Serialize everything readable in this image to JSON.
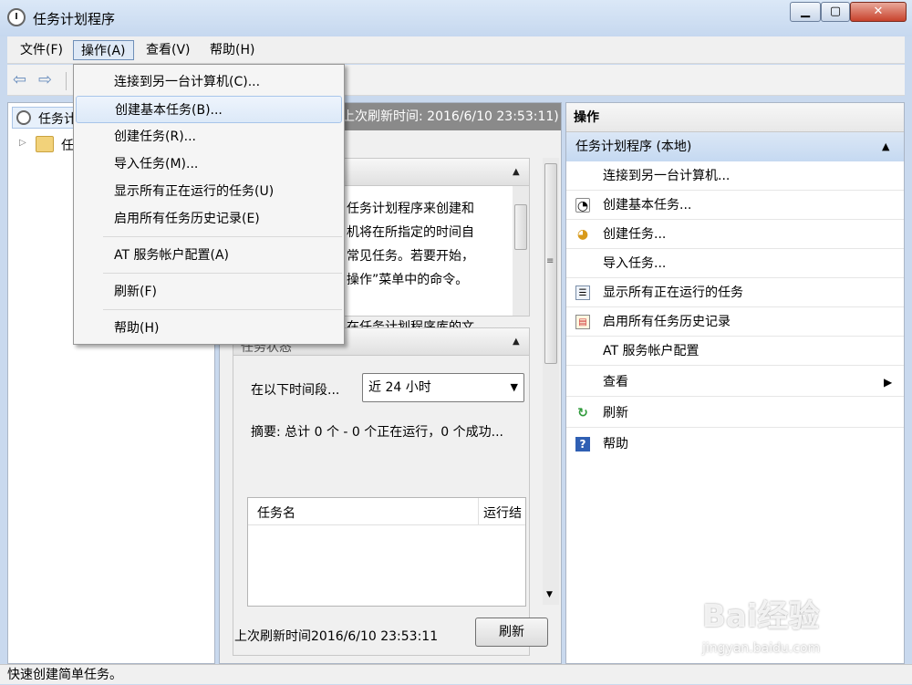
{
  "window": {
    "title": "任务计划程序",
    "min": "▁",
    "max": "▢",
    "close": "✕"
  },
  "menubar": {
    "items": [
      "文件(F)",
      "操作(A)",
      "查看(V)",
      "帮助(H)"
    ]
  },
  "toolbar": {
    "back": "⇦",
    "forward": "⇨"
  },
  "tree": {
    "root": "任务计",
    "child": "任"
  },
  "center": {
    "header": "上次刷新时间: 2016/6/10 23:53:11)",
    "overview_lines": [
      "任务计划程序来创建和",
      "机将在所指定的时间自",
      "常见任务。若要开始，",
      "操作”菜单中的命令。",
      "",
      "在任务计划程序库的文"
    ],
    "status_title": "任务状态",
    "period_label": "在以下时间段...",
    "period_value": "近 24 小时",
    "summary": "摘要: 总计 0 个 - 0 个正在运行，0 个成功...",
    "table_cols": [
      "任务名",
      "运行结"
    ],
    "last_refresh": "上次刷新时间2016/6/10 23:53:11",
    "refresh_btn": "刷新"
  },
  "actions": {
    "title": "操作",
    "group": "任务计划程序 (本地)",
    "items": [
      {
        "label": "连接到另一台计算机...",
        "icon": ""
      },
      {
        "label": "创建基本任务...",
        "icon": "clock-icon"
      },
      {
        "label": "创建任务...",
        "icon": "task-icon"
      },
      {
        "label": "导入任务...",
        "icon": ""
      },
      {
        "label": "显示所有正在运行的任务",
        "icon": "list-icon"
      },
      {
        "label": "启用所有任务历史记录",
        "icon": "history-icon"
      },
      {
        "label": "AT 服务帐户配置",
        "icon": ""
      },
      {
        "label": "查看",
        "icon": ""
      },
      {
        "label": "刷新",
        "icon": "refresh-icon"
      },
      {
        "label": "帮助",
        "icon": "help-icon"
      }
    ]
  },
  "dropdown": {
    "items": [
      "连接到另一台计算机(C)...",
      "创建基本任务(B)...",
      "创建任务(R)...",
      "导入任务(M)...",
      "显示所有正在运行的任务(U)",
      "启用所有任务历史记录(E)",
      "AT 服务帐户配置(A)",
      "刷新(F)",
      "帮助(H)"
    ]
  },
  "status": "快速创建简单任务。",
  "watermark": {
    "brand": "Bai经验",
    "url": "jingyan.baidu.com"
  }
}
